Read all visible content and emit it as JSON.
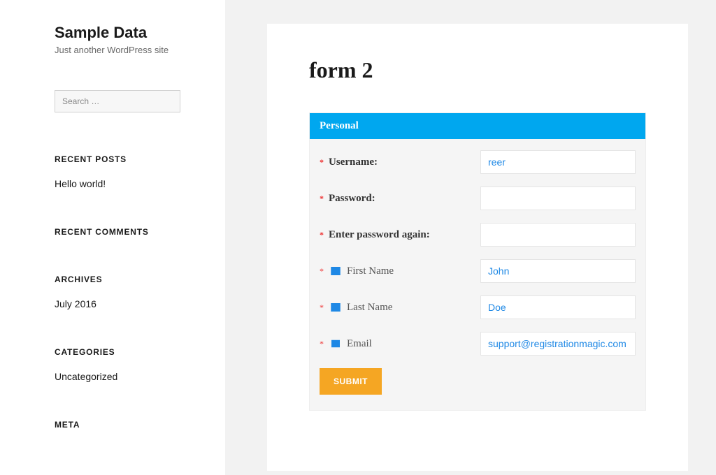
{
  "site": {
    "title": "Sample Data",
    "tagline": "Just another WordPress site"
  },
  "search": {
    "placeholder": "Search …"
  },
  "widgets": {
    "recent_posts": {
      "title": "RECENT POSTS",
      "item": "Hello world!"
    },
    "recent_comments": {
      "title": "RECENT COMMENTS"
    },
    "archives": {
      "title": "ARCHIVES",
      "item": "July 2016"
    },
    "categories": {
      "title": "CATEGORIES",
      "item": "Uncategorized"
    },
    "meta": {
      "title": "META"
    }
  },
  "page": {
    "heading": "form 2"
  },
  "form": {
    "section_label": "Personal",
    "fields": {
      "username": {
        "label": "Username:",
        "value": "reer"
      },
      "password": {
        "label": "Password:",
        "value": ""
      },
      "password_again": {
        "label": "Enter password again:",
        "value": ""
      },
      "first_name": {
        "label": "First Name",
        "value": "John"
      },
      "last_name": {
        "label": "Last Name",
        "value": "Doe"
      },
      "email": {
        "label": "Email",
        "value": "support@registrationmagic.com"
      }
    },
    "submit_label": "SUBMIT"
  }
}
